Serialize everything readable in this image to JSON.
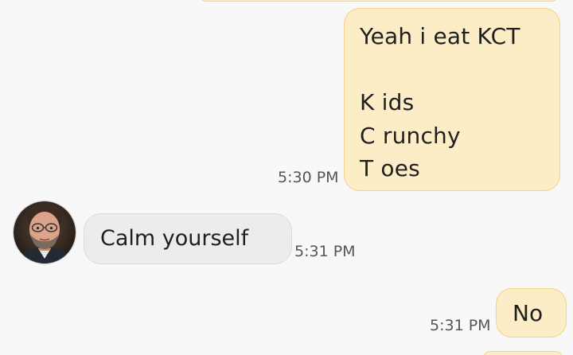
{
  "messages": [
    {
      "direction": "outgoing",
      "lines": [
        "Yeah i eat KCT",
        "",
        "K ids",
        "C runchy",
        "T oes"
      ],
      "time": "5:30 PM"
    },
    {
      "direction": "incoming",
      "text": "Calm yourself",
      "time": "5:31 PM",
      "avatar_icon": "contact-photo"
    },
    {
      "direction": "outgoing",
      "text": "No",
      "time": "5:31 PM"
    }
  ],
  "colors": {
    "outgoing_bubble": "#fdedc6",
    "outgoing_border": "#f2d38a",
    "incoming_bubble": "#ececec",
    "background": "#f8f8f8",
    "timestamp": "#555555"
  }
}
